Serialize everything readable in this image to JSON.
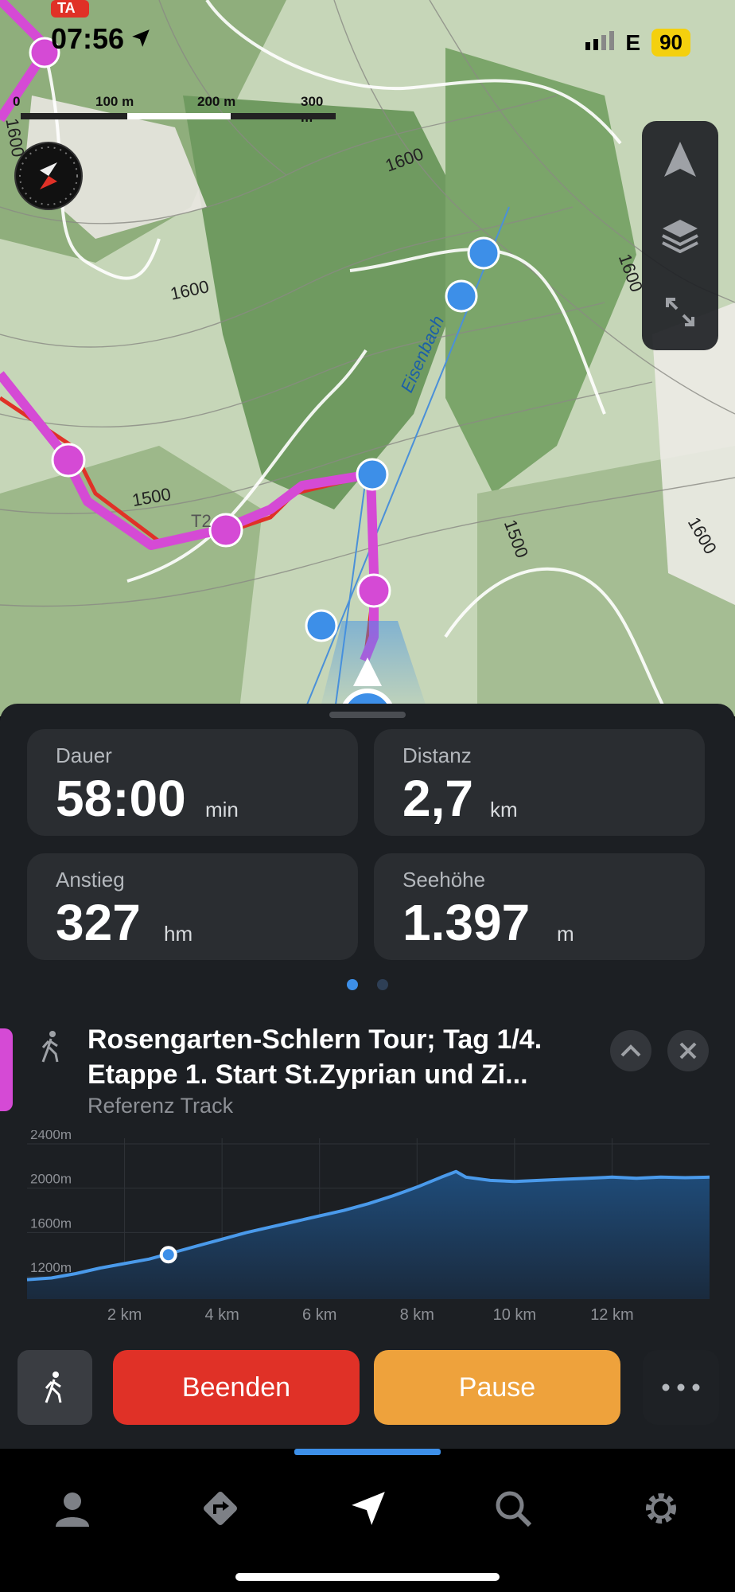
{
  "status_bar": {
    "time": "07:56",
    "network": "E",
    "battery": "90"
  },
  "map": {
    "scale_labels": [
      "0",
      "100 m",
      "200 m",
      "300 m"
    ],
    "contour_labels": [
      "1600",
      "1600",
      "1600",
      "1600",
      "1500",
      "1500",
      "1600"
    ],
    "stream_label": "Eisenbach",
    "trail_label": "T2",
    "top_tag": "TA"
  },
  "stats": [
    {
      "label": "Dauer",
      "value": "58:00",
      "unit": "min"
    },
    {
      "label": "Distanz",
      "value": "2,7",
      "unit": "km"
    },
    {
      "label": "Anstieg",
      "value": "327",
      "unit": "hm"
    },
    {
      "label": "Seehöhe",
      "value": "1.397",
      "unit": "m"
    }
  ],
  "page_indicator": {
    "count": 2,
    "active": 1
  },
  "tour": {
    "title_line1": "Rosengarten-Schlern Tour; Tag 1/4.",
    "title_line2": "Etappe 1. Start St.Zyprian und Zi...",
    "subtitle": "Referenz Track"
  },
  "chart_data": {
    "type": "area",
    "title": "",
    "xlabel": "",
    "ylabel": "",
    "x_unit": "km",
    "y_unit": "m",
    "x_ticks": [
      "2 km",
      "4 km",
      "6 km",
      "8 km",
      "10 km",
      "12 km"
    ],
    "y_ticks": [
      "2400m",
      "2000m",
      "1600m",
      "1200m"
    ],
    "xlim": [
      0,
      14
    ],
    "ylim": [
      1000,
      2450
    ],
    "series": [
      {
        "x": [
          0,
          0.5,
          1,
          1.5,
          2,
          2.5,
          3,
          3.5,
          4,
          4.5,
          5,
          5.5,
          6,
          6.5,
          7,
          7.5,
          8,
          8.5,
          8.8,
          9,
          9.5,
          10,
          10.5,
          11,
          11.5,
          12,
          12.5,
          13,
          13.5,
          14
        ],
        "y": [
          1175,
          1190,
          1230,
          1280,
          1320,
          1360,
          1420,
          1480,
          1540,
          1600,
          1650,
          1700,
          1750,
          1800,
          1860,
          1930,
          2010,
          2100,
          2150,
          2100,
          2070,
          2060,
          2070,
          2080,
          2090,
          2100,
          2090,
          2100,
          2095,
          2100
        ]
      }
    ],
    "current_position": {
      "x": 2.9,
      "y": 1400
    },
    "grid": true
  },
  "actions": {
    "end": "Beenden",
    "pause": "Pause"
  },
  "colors": {
    "accent": "#3d8fe8",
    "end": "#e03127",
    "pause": "#eea23c",
    "route": "#d54ad5"
  }
}
